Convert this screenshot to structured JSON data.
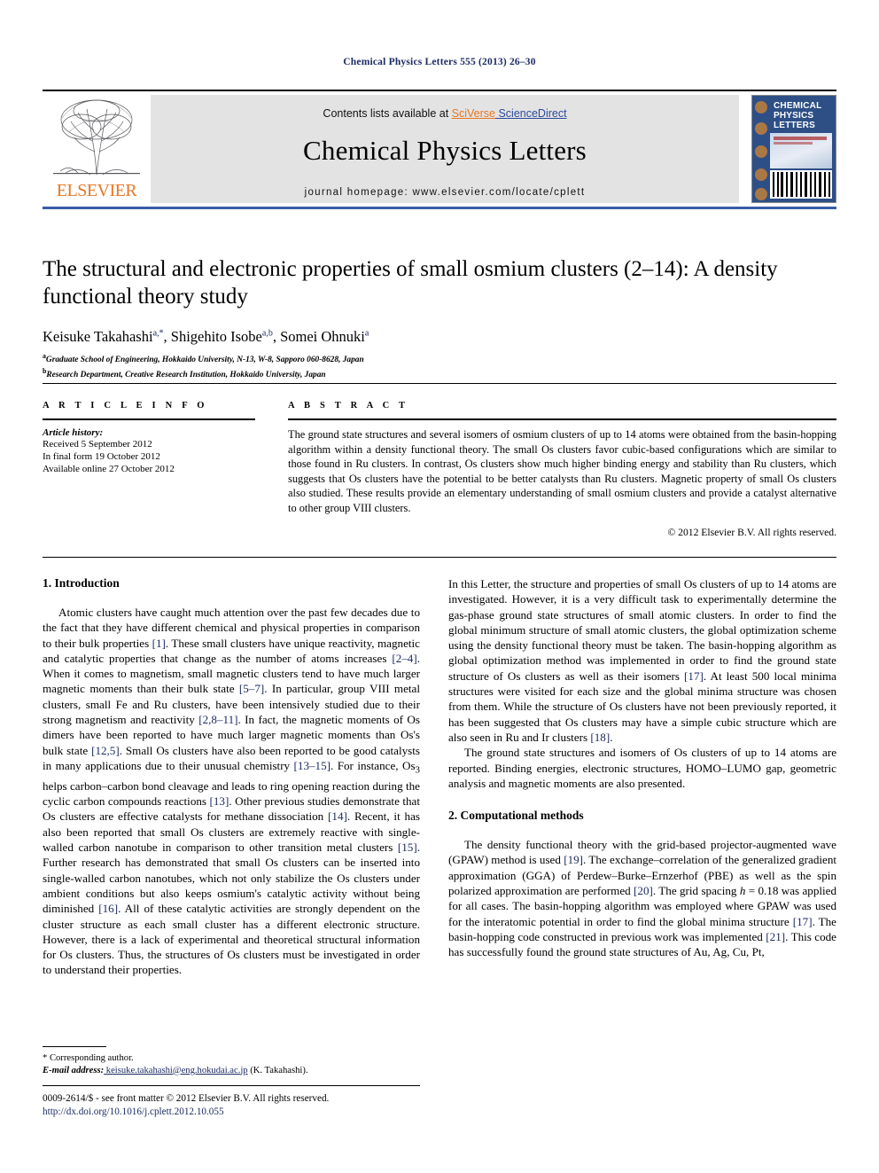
{
  "running_head": "Chemical Physics Letters 555 (2013) 26–30",
  "masthead": {
    "contents_prefix": "Contents lists available at ",
    "sciverse": "SciVerse",
    "sciencedirect": " ScienceDirect",
    "journal_title": "Chemical Physics Letters",
    "homepage": "journal homepage: www.elsevier.com/locate/cplett",
    "publisher_logo_text": "ELSEVIER",
    "cover_title_line1": "CHEMICAL",
    "cover_title_line2": "PHYSICS",
    "cover_title_line3": "LETTERS"
  },
  "article": {
    "title": "The structural and electronic properties of small osmium clusters (2–14): A density functional theory study",
    "authors": "Keisuke Takahashi",
    "author_sup_1": "a,*",
    "authors_2": ", Shigehito Isobe",
    "author_sup_2": "a,b",
    "authors_3": ", Somei Ohnuki",
    "author_sup_3": "a",
    "affiliation_a_sup": "a",
    "affiliation_a": "Graduate School of Engineering, Hokkaido University, N-13, W-8, Sapporo 060-8628, Japan",
    "affiliation_b_sup": "b",
    "affiliation_b": "Research Department, Creative Research Institution, Hokkaido University, Japan"
  },
  "article_info": {
    "heading": "A R T I C L E    I N F O",
    "history_label": "Article history:",
    "received": "Received 5 September 2012",
    "final_form": "In final form 19 October 2012",
    "available_online": "Available online 27 October 2012"
  },
  "abstract": {
    "heading": "A B S T R A C T",
    "text": "The ground state structures and several isomers of osmium clusters of up to 14 atoms were obtained from the basin-hopping algorithm within a density functional theory. The small Os clusters favor cubic-based configurations which are similar to those found in Ru clusters. In contrast, Os clusters show much higher binding energy and stability than Ru clusters, which suggests that Os clusters have the potential to be better catalysts than Ru clusters. Magnetic property of small Os clusters also studied. These results provide an elementary understanding of small osmium clusters and provide a catalyst alternative to other group VIII clusters.",
    "copyright": "© 2012 Elsevier B.V. All rights reserved."
  },
  "sections": {
    "introduction_heading": "1. Introduction",
    "intro_p1_a": "Atomic clusters have caught much attention over the past few decades due to the fact that they have different chemical and physical properties in comparison to their bulk properties ",
    "intro_ref_1": "[1]",
    "intro_p1_b": ". These small clusters have unique reactivity, magnetic and catalytic properties that change as the number of atoms increases ",
    "intro_ref_2": "[2–4]",
    "intro_p1_c": ". When it comes to magnetism, small magnetic clusters tend to have much larger magnetic moments than their bulk state ",
    "intro_ref_3": "[5–7]",
    "intro_p1_d": ". In particular, group VIII metal clusters, small Fe and Ru clusters, have been intensively studied due to their strong magnetism and reactivity ",
    "intro_ref_4": "[2,8–11]",
    "intro_p1_e": ". In fact, the magnetic moments of Os dimers have been reported to have much larger magnetic moments than Os's bulk state ",
    "intro_ref_5": "[12,5]",
    "intro_p1_f": ". Small Os clusters have also been reported to be good catalysts in many applications due to their unusual chemistry ",
    "intro_ref_6": "[13–15]",
    "intro_p1_g": ". For instance, Os",
    "intro_p1_g_sub": "3",
    "intro_p1_h": " helps carbon–carbon bond cleavage and leads to ring opening reaction during the cyclic carbon compounds reactions ",
    "intro_ref_7": "[13]",
    "intro_p1_i": ". Other previous studies demonstrate that Os clusters are effective catalysts for methane dissociation ",
    "intro_ref_8": "[14]",
    "intro_p1_j": ". Recent, it has also been reported that small Os clusters are extremely reactive with single-walled carbon nanotube in comparison to other transition metal clusters ",
    "intro_ref_9": "[15]",
    "intro_p1_k": ". Further research has demonstrated that small Os clusters can be inserted into single-walled carbon nanotubes, which not only stabilize the Os clusters under ambient conditions but also keeps osmium's catalytic activity without being diminished ",
    "intro_ref_10": "[16]",
    "intro_p1_l": ". All of these catalytic activities are strongly dependent on the cluster structure as each small cluster has a different electronic structure. However, there is a lack of experimental and theoretical structural information for Os clusters. Thus, the structures of Os clusters must be investigated in order to understand their properties.",
    "intro_p2_a": "In this Letter, the structure and properties of small Os clusters of up to 14 atoms are investigated. However, it is a very difficult task to experimentally determine the gas-phase ground state structures of small atomic clusters. In order to find the global minimum structure of small atomic clusters, the global optimization scheme using the density functional theory must be taken. The basin-hopping algorithm as global optimization method was implemented in order to find the ground state structure of Os clusters as well as their isomers ",
    "intro_ref_11": "[17]",
    "intro_p2_b": ". At least 500 local minima structures were visited for each size and the global minima structure was chosen from them. While the structure of Os clusters have not been previously reported, it has been suggested that Os clusters may have a simple cubic structure which are also seen in Ru and Ir clusters ",
    "intro_ref_12": "[18]",
    "intro_p2_c": ".",
    "intro_p3": "The ground state structures and isomers of Os clusters of up to 14 atoms are reported. Binding energies, electronic structures, HOMO–LUMO gap, geometric analysis and magnetic moments are also presented.",
    "methods_heading": "2. Computational methods",
    "methods_p1_a": "The density functional theory with the grid-based projector-augmented wave (GPAW) method is used ",
    "methods_ref_1": "[19]",
    "methods_p1_b": ". The exchange–correlation of the generalized gradient approximation (GGA) of Perdew–Burke–Ernzerhof (PBE) as well as the spin polarized approximation are performed ",
    "methods_ref_2": "[20]",
    "methods_p1_c": ". The grid spacing ",
    "methods_p1_h": "h",
    "methods_p1_d": " = 0.18 was applied for all cases. The basin-hopping algorithm was employed where GPAW was used for the interatomic potential in order to find the global minima structure ",
    "methods_ref_3": "[17]",
    "methods_p1_e": ". The basin-hopping code constructed in previous work was implemented ",
    "methods_ref_4": "[21]",
    "methods_p1_f": ". This code has successfully found the ground state structures of Au, Ag, Cu, Pt,"
  },
  "footnote": {
    "corresponding": "* Corresponding author.",
    "email_label": "E-mail address:",
    "email": " keisuke.takahashi@eng.hokudai.ac.jp",
    "email_suffix": " (K. Takahashi)."
  },
  "footer": {
    "issn_line": "0009-2614/$ - see front matter © 2012 Elsevier B.V. All rights reserved.",
    "doi": "http://dx.doi.org/10.1016/j.cplett.2012.10.055"
  },
  "colors": {
    "header_blue": "#1c2b63",
    "elsevier_orange": "#e87722",
    "sciencedirect_blue": "#2b4a9b",
    "rule_blue": "#3a5da8"
  }
}
